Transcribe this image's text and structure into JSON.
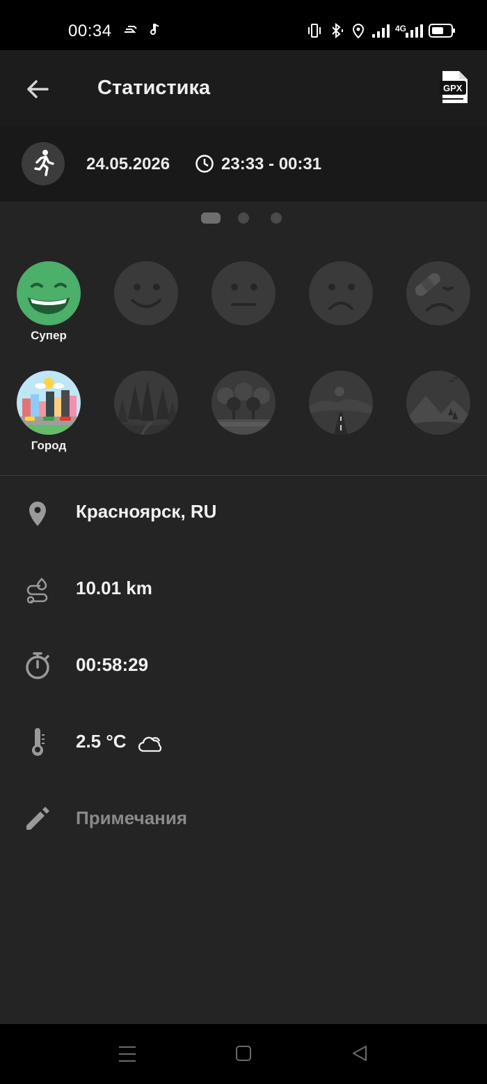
{
  "status_bar": {
    "time": "00:34",
    "network": "4G"
  },
  "app_bar": {
    "title": "Статистика",
    "export_label": "GPX"
  },
  "run": {
    "date": "24.05.2026",
    "time_range": "23:33 - 00:31"
  },
  "pager": {
    "pages": 3,
    "active": 0
  },
  "moods": {
    "selected_label": "Супер",
    "items": [
      "super-happy-face",
      "smile-face",
      "neutral-face",
      "sad-face",
      "injured-face"
    ]
  },
  "terrains": {
    "selected_label": "Город",
    "items": [
      "city",
      "forest",
      "park",
      "road",
      "mountains"
    ]
  },
  "details": {
    "location": "Красноярск, RU",
    "distance": "10.01 km",
    "duration": "00:58:29",
    "temperature": "2.5 °C",
    "notes_placeholder": "Примечания"
  },
  "colors": {
    "accent_green": "#4caf6a",
    "background": "#242424"
  }
}
